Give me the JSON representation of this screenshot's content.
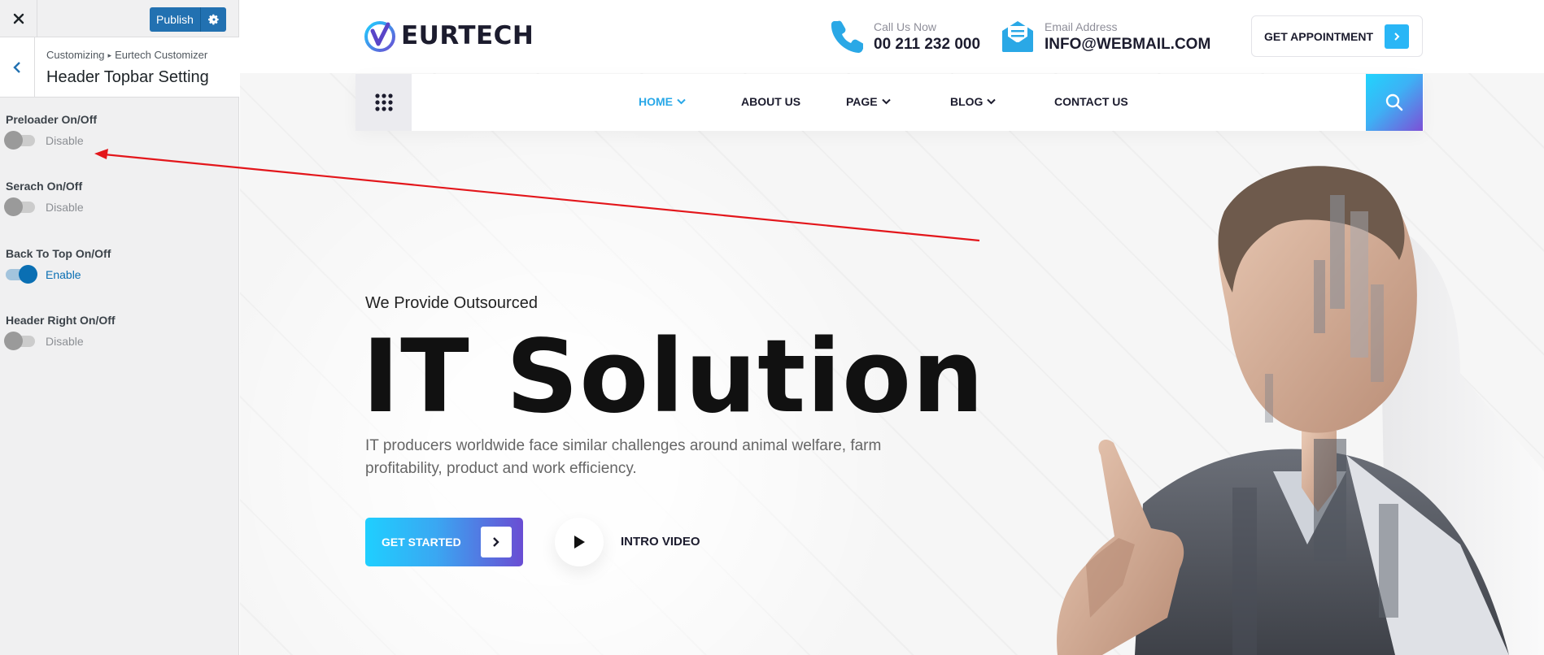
{
  "sidebar": {
    "close_icon": "close-icon",
    "publish_label": "Publish",
    "settings_icon": "gear-icon",
    "back_icon": "chevron-left-icon",
    "breadcrumb": [
      "Customizing",
      "Eurtech Customizer"
    ],
    "section_title": "Header Topbar Setting",
    "controls": [
      {
        "label": "Preloader On/Off",
        "state": "Disable",
        "enabled": false
      },
      {
        "label": "Serach On/Off",
        "state": "Disable",
        "enabled": false
      },
      {
        "label": "Back To Top On/Off",
        "state": "Enable",
        "enabled": true
      },
      {
        "label": "Header Right On/Off",
        "state": "Disable",
        "enabled": false
      }
    ]
  },
  "site": {
    "logo_text": "EURTECH",
    "phone": {
      "caption": "Call Us Now",
      "value": "00 211 232 000",
      "icon": "phone-icon"
    },
    "email": {
      "caption": "Email Address",
      "value": "INFO@WEBMAIL.COM",
      "icon": "envelope-icon"
    },
    "appointment_label": "GET APPOINTMENT",
    "nav": [
      "HOME",
      "ABOUT US",
      "PAGE",
      "BLOG",
      "CONTACT US"
    ],
    "hero": {
      "subtitle": "We Provide Outsourced",
      "title": "IT Solution",
      "description": "IT producers worldwide face similar challenges around animal welfare, farm profitability, product and work efficiency.",
      "cta_label": "GET STARTED",
      "video_label": "INTRO VIDEO"
    },
    "colors": {
      "accent": "#29a8e8",
      "wp_blue": "#2271b1",
      "toggle_on": "#0a6fb3",
      "annotation": "#e3161b"
    }
  }
}
